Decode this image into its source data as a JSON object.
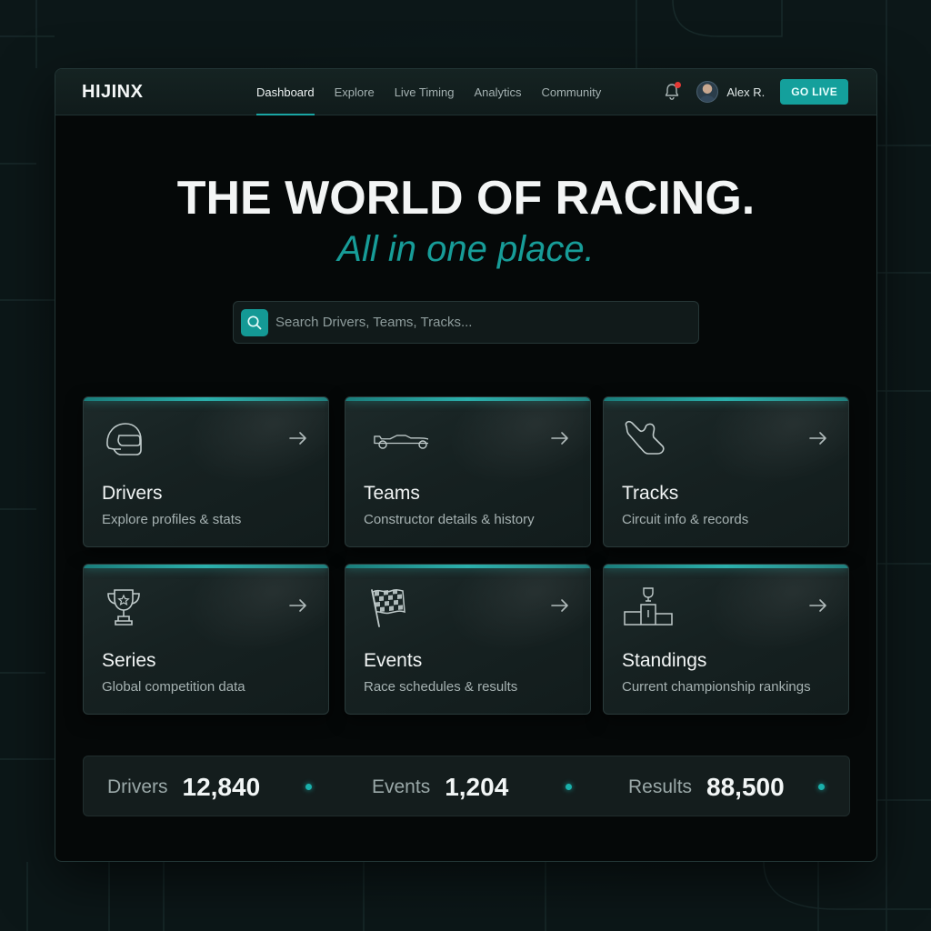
{
  "app": {
    "logo": "HIJINX"
  },
  "nav": {
    "items": [
      {
        "label": "Dashboard",
        "active": true
      },
      {
        "label": "Explore",
        "active": false
      },
      {
        "label": "Live Timing",
        "active": false
      },
      {
        "label": "Analytics",
        "active": false
      },
      {
        "label": "Community",
        "active": false
      }
    ]
  },
  "user": {
    "name": "Alex R.",
    "notification_icon": "bell-icon",
    "has_unread": true
  },
  "actions": {
    "go_live_label": "GO LIVE"
  },
  "hero": {
    "title": "THE WORLD OF RACING.",
    "subtitle": "All in one place."
  },
  "search": {
    "placeholder": "Search Drivers, Teams, Tracks..."
  },
  "cards": [
    {
      "title": "Drivers",
      "description": "Explore profiles & stats",
      "icon": "helmet-icon"
    },
    {
      "title": "Teams",
      "description": "Constructor details & history",
      "icon": "race-car-icon"
    },
    {
      "title": "Tracks",
      "description": "Circuit info & records",
      "icon": "circuit-icon"
    },
    {
      "title": "Series",
      "description": "Global competition data",
      "icon": "trophy-icon"
    },
    {
      "title": "Events",
      "description": "Race schedules & results",
      "icon": "checkered-flag-icon"
    },
    {
      "title": "Standings",
      "description": "Current championship rankings",
      "icon": "podium-icon"
    }
  ],
  "stats": [
    {
      "label": "Drivers",
      "value": "12,840"
    },
    {
      "label": "Events",
      "value": "1,204"
    },
    {
      "label": "Results",
      "value": "88,500"
    }
  ],
  "colors": {
    "accent": "#14a09c",
    "background": "#050808",
    "notification": "#e53935"
  }
}
